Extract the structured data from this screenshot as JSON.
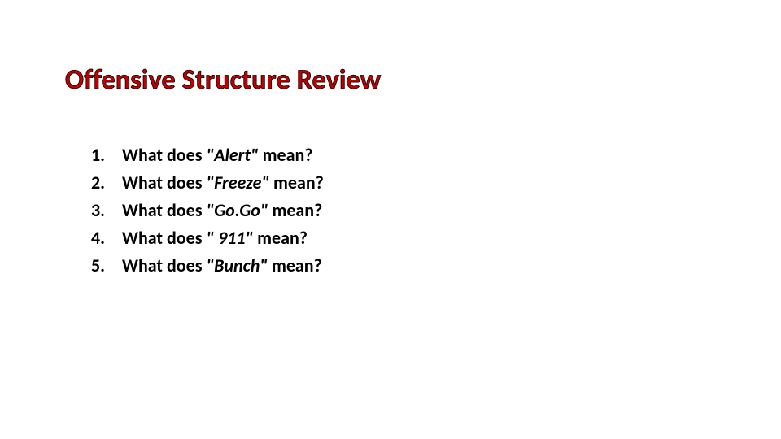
{
  "title": "Offensive Structure Review",
  "items": [
    {
      "num": "1.",
      "lead": "What does ",
      "term": "\"Alert\"",
      "tail": " mean?"
    },
    {
      "num": "2.",
      "lead": "What does ",
      "term": "\"Freeze\"",
      "tail": " mean?"
    },
    {
      "num": "3.",
      "lead": "What does ",
      "term": "\"Go.Go\"",
      "tail": " mean?"
    },
    {
      "num": "4.",
      "lead": "What does ",
      "term": "\" 911\"",
      "tail": " mean?"
    },
    {
      "num": "5.",
      "lead": "What does ",
      "term": "\"Bunch\"",
      "tail": " mean?"
    }
  ]
}
